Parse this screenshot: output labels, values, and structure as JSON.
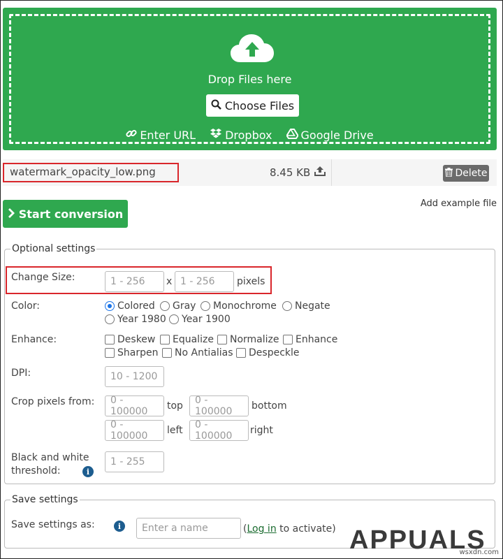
{
  "upload": {
    "drop_text": "Drop Files here",
    "choose_label": "Choose Files",
    "sources": [
      "Enter URL",
      "Dropbox",
      "Google Drive"
    ]
  },
  "file": {
    "name": "watermark_opacity_low.png",
    "size": "8.45 KB",
    "delete_label": "Delete"
  },
  "actions": {
    "start_label": "Start conversion",
    "add_example_label": "Add example file"
  },
  "optional": {
    "legend": "Optional settings",
    "size": {
      "label": "Change Size:",
      "width_placeholder": "1 - 256",
      "sep": "x",
      "height_placeholder": "1 - 256",
      "unit": "pixels"
    },
    "color": {
      "label": "Color:",
      "options": [
        "Colored",
        "Gray",
        "Monochrome",
        "Negate",
        "Year 1980",
        "Year 1900"
      ],
      "selected": "Colored"
    },
    "enhance": {
      "label": "Enhance:",
      "options": [
        "Deskew",
        "Equalize",
        "Normalize",
        "Enhance",
        "Sharpen",
        "No Antialias",
        "Despeckle"
      ]
    },
    "dpi": {
      "label": "DPI:",
      "placeholder": "10 - 1200"
    },
    "crop": {
      "label": "Crop pixels from:",
      "placeholder": "0 - 100000",
      "top": "top",
      "bottom": "bottom",
      "left": "left",
      "right": "right"
    },
    "threshold": {
      "label_line1": "Black and white",
      "label_line2": "threshold:",
      "placeholder": "1 - 255"
    }
  },
  "save": {
    "legend": "Save settings",
    "label": "Save settings as:",
    "placeholder": "Enter a name",
    "paren_open": "(",
    "login_label": "Log in",
    "activate_text": "to activate)"
  },
  "watermark": {
    "brand": "APPUALS",
    "site": "wsxdn.com"
  },
  "colors": {
    "green": "#2fa84f",
    "highlight_red": "#d9262b",
    "radio_blue": "#1a73e8"
  }
}
